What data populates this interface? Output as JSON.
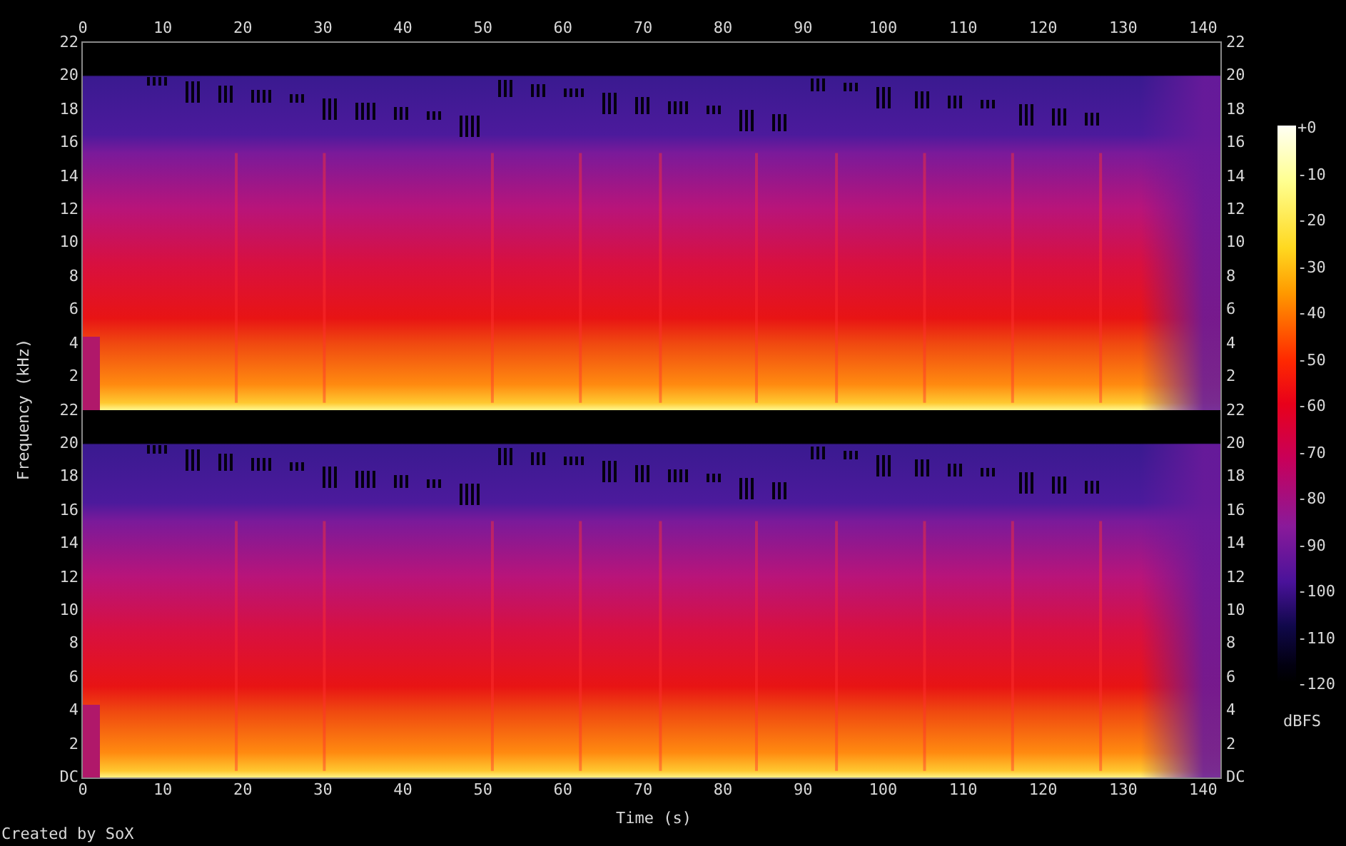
{
  "x_axis": {
    "label": "Time (s)",
    "top_ticks": [
      "0",
      "10",
      "20",
      "30",
      "40",
      "50",
      "60",
      "70",
      "80",
      "90",
      "100",
      "110",
      "120",
      "130",
      "140"
    ],
    "bottom_ticks": [
      "0",
      "10",
      "20",
      "30",
      "40",
      "50",
      "60",
      "70",
      "80",
      "90",
      "100",
      "110",
      "120",
      "130",
      "140"
    ]
  },
  "y_axis": {
    "label": "Frequency (kHz)"
  },
  "channels": [
    {
      "left_ticks": [
        "22",
        "20",
        "18",
        "16",
        "14",
        "12",
        "10",
        "8",
        "6",
        "4",
        "2"
      ],
      "right_ticks": [
        "22",
        "20",
        "18",
        "16",
        "14",
        "12",
        "10",
        "8",
        "6",
        "4",
        "2"
      ]
    },
    {
      "left_ticks": [
        "22",
        "20",
        "18",
        "16",
        "14",
        "12",
        "10",
        "8",
        "6",
        "4",
        "2",
        "DC"
      ],
      "right_ticks": [
        "22",
        "20",
        "18",
        "16",
        "14",
        "12",
        "10",
        "8",
        "6",
        "4",
        "2",
        "DC"
      ]
    }
  ],
  "colorbar": {
    "ticks": [
      "+0",
      "-10",
      "-20",
      "-30",
      "-40",
      "-50",
      "-60",
      "-70",
      "-80",
      "-90",
      "-100",
      "-110",
      "-120"
    ],
    "unit": "dBFS"
  },
  "credit": "Created by SoX"
}
